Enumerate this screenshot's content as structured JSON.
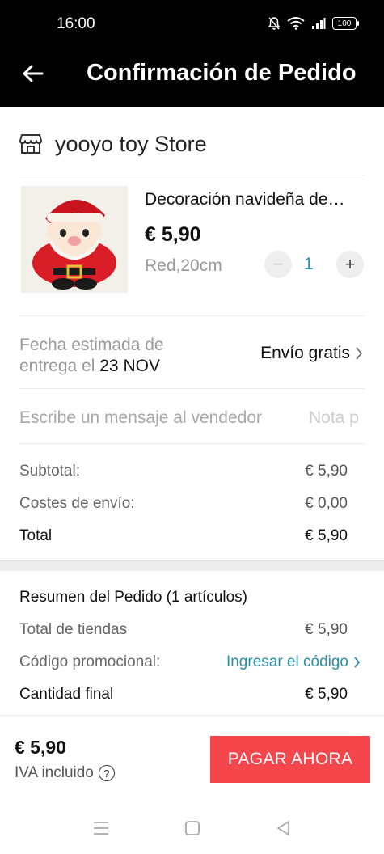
{
  "status_bar": {
    "time": "16:00",
    "battery": "100",
    "icons": [
      "mute-bell-icon",
      "wifi-icon",
      "signal-icon",
      "battery-icon"
    ]
  },
  "header": {
    "title": "Confirmación de Pedido",
    "back_icon": "arrow-left-icon"
  },
  "store": {
    "name": "yooyo toy Store",
    "icon": "store-icon"
  },
  "product": {
    "title": "Decoración navideña de…",
    "price": "€ 5,90",
    "variant": "Red,20cm",
    "quantity": "1",
    "minus": "−",
    "plus": "+"
  },
  "delivery": {
    "label_line1": "Fecha estimada de",
    "label_line2_prefix": "entrega el ",
    "date": "23 NOV",
    "shipping": "Envío gratis"
  },
  "message": {
    "placeholder": "Escribe un mensaje al vendedor",
    "note": "Nota p"
  },
  "costs": [
    {
      "label": "Subtotal:",
      "value": "€ 5,90"
    },
    {
      "label": "Costes de envío:",
      "value": "€ 0,00"
    },
    {
      "label": "Total",
      "value": "€ 5,90"
    }
  ],
  "summary": {
    "title": "Resumen del Pedido (1 artículos)",
    "stores_label": "Total de tiendas",
    "stores_value": "€ 5,90",
    "promo_label": "Código promocional:",
    "promo_link": "Ingresar el código",
    "final_label": "Cantidad final",
    "final_value": "€ 5,90"
  },
  "footer": {
    "total": "€ 5,90",
    "iva": "IVA incluido",
    "help": "?",
    "pay_button": "PAGAR AHORA"
  },
  "colors": {
    "accent": "#2a8fa8",
    "pay": "#f5464c",
    "header_bg": "#000000"
  }
}
